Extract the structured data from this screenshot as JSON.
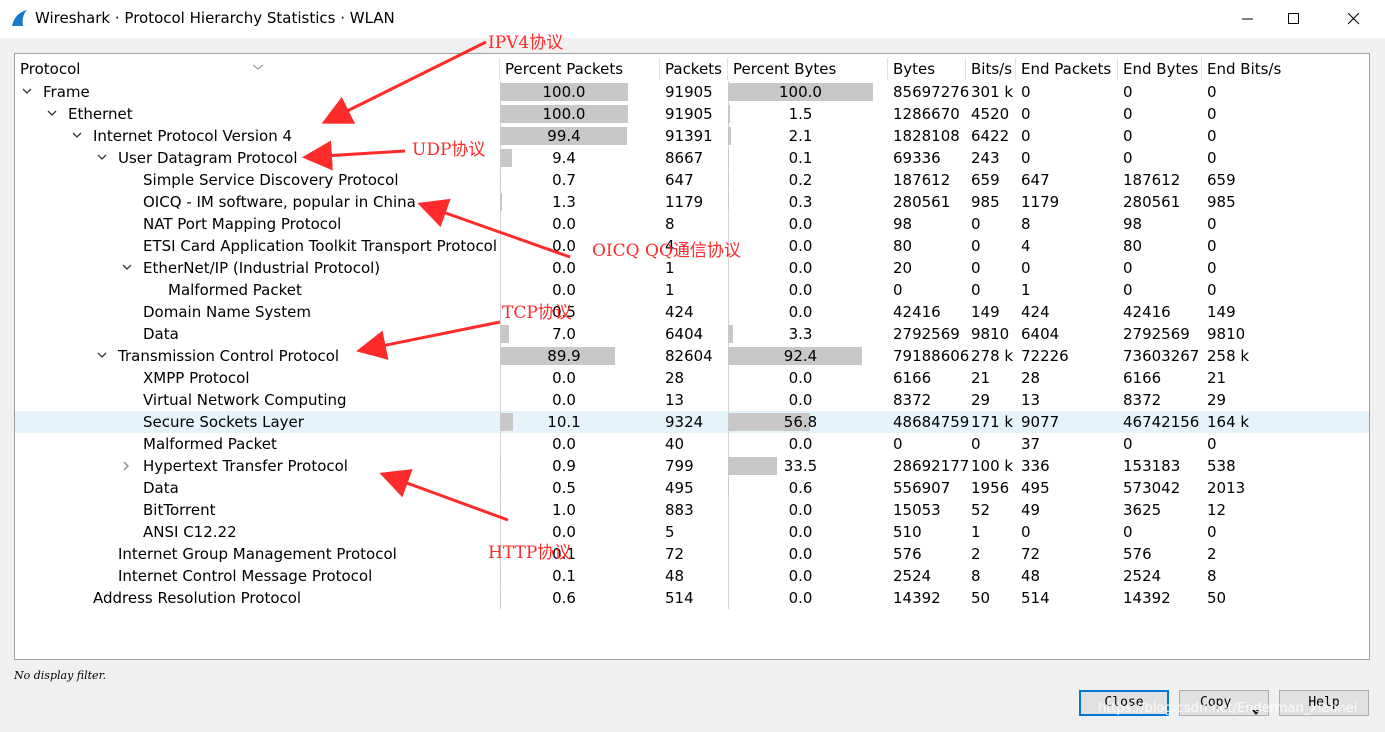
{
  "window": {
    "title": "Wireshark · Protocol Hierarchy Statistics · WLAN"
  },
  "columns": [
    "Protocol",
    "Percent Packets",
    "Packets",
    "Percent Bytes",
    "Bytes",
    "Bits/s",
    "End Packets",
    "End Bytes",
    "End Bits/s"
  ],
  "rows": [
    {
      "name": "Frame",
      "level": 0,
      "expand": "down",
      "pct_packets": "100.0",
      "pct_packets_val": 100.0,
      "packets": "91905",
      "pct_bytes": "100.0",
      "pct_bytes_val": 100.0,
      "bytes": "85697276",
      "bits": "301 k",
      "end_packets": "0",
      "end_bytes": "0",
      "end_bits": "0"
    },
    {
      "name": "Ethernet",
      "level": 1,
      "expand": "down",
      "pct_packets": "100.0",
      "pct_packets_val": 100.0,
      "packets": "91905",
      "pct_bytes": "1.5",
      "pct_bytes_val": 1.5,
      "bytes": "1286670",
      "bits": "4520",
      "end_packets": "0",
      "end_bytes": "0",
      "end_bits": "0"
    },
    {
      "name": "Internet Protocol Version 4",
      "level": 2,
      "expand": "down",
      "pct_packets": "99.4",
      "pct_packets_val": 99.4,
      "packets": "91391",
      "pct_bytes": "2.1",
      "pct_bytes_val": 2.1,
      "bytes": "1828108",
      "bits": "6422",
      "end_packets": "0",
      "end_bytes": "0",
      "end_bits": "0"
    },
    {
      "name": "User Datagram Protocol",
      "level": 3,
      "expand": "down",
      "pct_packets": "9.4",
      "pct_packets_val": 9.4,
      "packets": "8667",
      "pct_bytes": "0.1",
      "pct_bytes_val": 0.1,
      "bytes": "69336",
      "bits": "243",
      "end_packets": "0",
      "end_bytes": "0",
      "end_bits": "0"
    },
    {
      "name": "Simple Service Discovery Protocol",
      "level": 4,
      "expand": "",
      "pct_packets": "0.7",
      "pct_packets_val": 0.7,
      "packets": "647",
      "pct_bytes": "0.2",
      "pct_bytes_val": 0.2,
      "bytes": "187612",
      "bits": "659",
      "end_packets": "647",
      "end_bytes": "187612",
      "end_bits": "659"
    },
    {
      "name": "OICQ - IM software, popular in China",
      "level": 4,
      "expand": "",
      "pct_packets": "1.3",
      "pct_packets_val": 1.3,
      "packets": "1179",
      "pct_bytes": "0.3",
      "pct_bytes_val": 0.3,
      "bytes": "280561",
      "bits": "985",
      "end_packets": "1179",
      "end_bytes": "280561",
      "end_bits": "985"
    },
    {
      "name": "NAT Port Mapping Protocol",
      "level": 4,
      "expand": "",
      "pct_packets": "0.0",
      "pct_packets_val": 0.0,
      "packets": "8",
      "pct_bytes": "0.0",
      "pct_bytes_val": 0.0,
      "bytes": "98",
      "bits": "0",
      "end_packets": "8",
      "end_bytes": "98",
      "end_bits": "0"
    },
    {
      "name": "ETSI Card Application Toolkit Transport Protocol",
      "level": 4,
      "expand": "",
      "pct_packets": "0.0",
      "pct_packets_val": 0.0,
      "packets": "4",
      "pct_bytes": "0.0",
      "pct_bytes_val": 0.0,
      "bytes": "80",
      "bits": "0",
      "end_packets": "4",
      "end_bytes": "80",
      "end_bits": "0"
    },
    {
      "name": "EtherNet/IP (Industrial Protocol)",
      "level": 4,
      "expand": "down",
      "pct_packets": "0.0",
      "pct_packets_val": 0.0,
      "packets": "1",
      "pct_bytes": "0.0",
      "pct_bytes_val": 0.0,
      "bytes": "20",
      "bits": "0",
      "end_packets": "0",
      "end_bytes": "0",
      "end_bits": "0"
    },
    {
      "name": "Malformed Packet",
      "level": 5,
      "expand": "",
      "pct_packets": "0.0",
      "pct_packets_val": 0.0,
      "packets": "1",
      "pct_bytes": "0.0",
      "pct_bytes_val": 0.0,
      "bytes": "0",
      "bits": "0",
      "end_packets": "1",
      "end_bytes": "0",
      "end_bits": "0"
    },
    {
      "name": "Domain Name System",
      "level": 4,
      "expand": "",
      "pct_packets": "0.5",
      "pct_packets_val": 0.5,
      "packets": "424",
      "pct_bytes": "0.0",
      "pct_bytes_val": 0.0,
      "bytes": "42416",
      "bits": "149",
      "end_packets": "424",
      "end_bytes": "42416",
      "end_bits": "149"
    },
    {
      "name": "Data",
      "level": 4,
      "expand": "",
      "pct_packets": "7.0",
      "pct_packets_val": 7.0,
      "packets": "6404",
      "pct_bytes": "3.3",
      "pct_bytes_val": 3.3,
      "bytes": "2792569",
      "bits": "9810",
      "end_packets": "6404",
      "end_bytes": "2792569",
      "end_bits": "9810"
    },
    {
      "name": "Transmission Control Protocol",
      "level": 3,
      "expand": "down",
      "pct_packets": "89.9",
      "pct_packets_val": 89.9,
      "packets": "82604",
      "pct_bytes": "92.4",
      "pct_bytes_val": 92.4,
      "bytes": "79188606",
      "bits": "278 k",
      "end_packets": "72226",
      "end_bytes": "73603267",
      "end_bits": "258 k"
    },
    {
      "name": "XMPP Protocol",
      "level": 4,
      "expand": "",
      "pct_packets": "0.0",
      "pct_packets_val": 0.0,
      "packets": "28",
      "pct_bytes": "0.0",
      "pct_bytes_val": 0.0,
      "bytes": "6166",
      "bits": "21",
      "end_packets": "28",
      "end_bytes": "6166",
      "end_bits": "21"
    },
    {
      "name": "Virtual Network Computing",
      "level": 4,
      "expand": "",
      "pct_packets": "0.0",
      "pct_packets_val": 0.0,
      "packets": "13",
      "pct_bytes": "0.0",
      "pct_bytes_val": 0.0,
      "bytes": "8372",
      "bits": "29",
      "end_packets": "13",
      "end_bytes": "8372",
      "end_bits": "29"
    },
    {
      "name": "Secure Sockets Layer",
      "level": 4,
      "expand": "",
      "selected": true,
      "pct_packets": "10.1",
      "pct_packets_val": 10.1,
      "packets": "9324",
      "pct_bytes": "56.8",
      "pct_bytes_val": 56.8,
      "bytes": "48684759",
      "bits": "171 k",
      "end_packets": "9077",
      "end_bytes": "46742156",
      "end_bits": "164 k"
    },
    {
      "name": "Malformed Packet",
      "level": 4,
      "expand": "",
      "pct_packets": "0.0",
      "pct_packets_val": 0.0,
      "packets": "40",
      "pct_bytes": "0.0",
      "pct_bytes_val": 0.0,
      "bytes": "0",
      "bits": "0",
      "end_packets": "37",
      "end_bytes": "0",
      "end_bits": "0"
    },
    {
      "name": "Hypertext Transfer Protocol",
      "level": 4,
      "expand": "right",
      "pct_packets": "0.9",
      "pct_packets_val": 0.9,
      "packets": "799",
      "pct_bytes": "33.5",
      "pct_bytes_val": 33.5,
      "bytes": "28692177",
      "bits": "100 k",
      "end_packets": "336",
      "end_bytes": "153183",
      "end_bits": "538"
    },
    {
      "name": "Data",
      "level": 4,
      "expand": "",
      "pct_packets": "0.5",
      "pct_packets_val": 0.5,
      "packets": "495",
      "pct_bytes": "0.6",
      "pct_bytes_val": 0.6,
      "bytes": "556907",
      "bits": "1956",
      "end_packets": "495",
      "end_bytes": "573042",
      "end_bits": "2013"
    },
    {
      "name": "BitTorrent",
      "level": 4,
      "expand": "",
      "pct_packets": "1.0",
      "pct_packets_val": 1.0,
      "packets": "883",
      "pct_bytes": "0.0",
      "pct_bytes_val": 0.0,
      "bytes": "15053",
      "bits": "52",
      "end_packets": "49",
      "end_bytes": "3625",
      "end_bits": "12"
    },
    {
      "name": "ANSI C12.22",
      "level": 4,
      "expand": "",
      "pct_packets": "0.0",
      "pct_packets_val": 0.0,
      "packets": "5",
      "pct_bytes": "0.0",
      "pct_bytes_val": 0.0,
      "bytes": "510",
      "bits": "1",
      "end_packets": "0",
      "end_bytes": "0",
      "end_bits": "0"
    },
    {
      "name": "Internet Group Management Protocol",
      "level": 3,
      "expand": "",
      "pct_packets": "0.1",
      "pct_packets_val": 0.1,
      "packets": "72",
      "pct_bytes": "0.0",
      "pct_bytes_val": 0.0,
      "bytes": "576",
      "bits": "2",
      "end_packets": "72",
      "end_bytes": "576",
      "end_bits": "2"
    },
    {
      "name": "Internet Control Message Protocol",
      "level": 3,
      "expand": "",
      "pct_packets": "0.1",
      "pct_packets_val": 0.1,
      "packets": "48",
      "pct_bytes": "0.0",
      "pct_bytes_val": 0.0,
      "bytes": "2524",
      "bits": "8",
      "end_packets": "48",
      "end_bytes": "2524",
      "end_bits": "8"
    },
    {
      "name": "Address Resolution Protocol",
      "level": 2,
      "expand": "",
      "pct_packets": "0.6",
      "pct_packets_val": 0.6,
      "packets": "514",
      "pct_bytes": "0.0",
      "pct_bytes_val": 0.0,
      "bytes": "14392",
      "bits": "50",
      "end_packets": "514",
      "end_bytes": "14392",
      "end_bits": "50"
    }
  ],
  "status": {
    "filter_text": "No display filter."
  },
  "buttons": {
    "close": "Close",
    "copy": "Copy",
    "help": "Help"
  },
  "annotations": {
    "ipv4": "IPV4协议",
    "udp": "UDP协议",
    "oicq": "OICQ QQ通信协议",
    "tcp": "TCP协议",
    "http": "HTTP协议"
  },
  "watermark": "https://blog.csdn.net/Enderman_xiaohei",
  "colors": {
    "bar": "#c8c8c8",
    "selected_row": "#e5f3fb",
    "annotation": "#ff2a2a",
    "default_button_border": "#0078d7"
  }
}
